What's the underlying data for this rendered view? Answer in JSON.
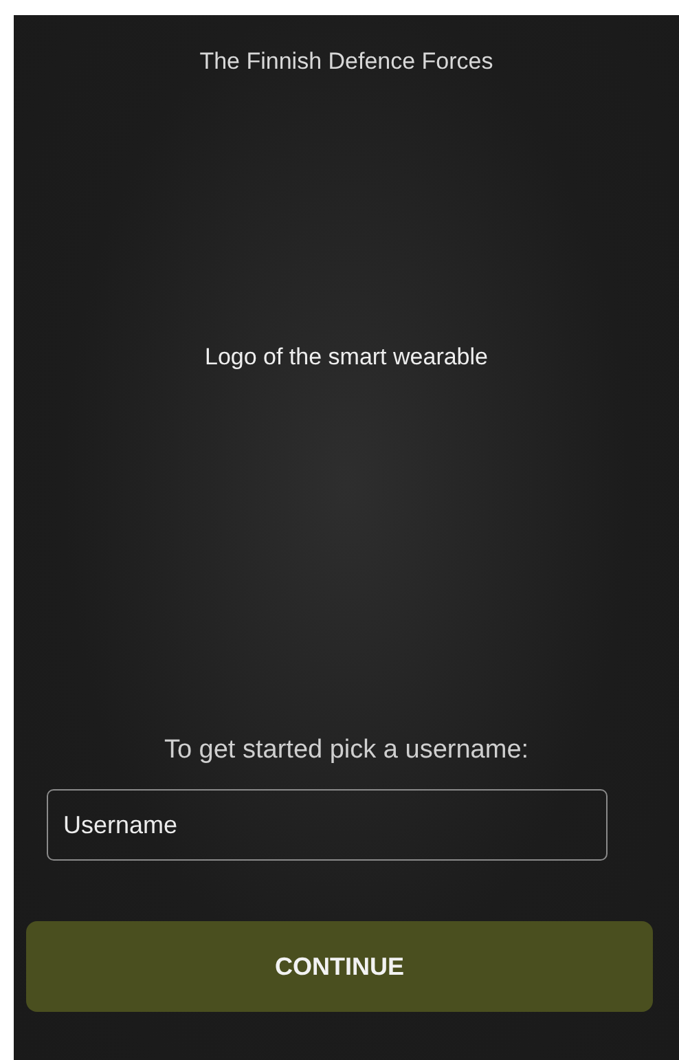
{
  "header": {
    "title": "The Finnish Defence Forces"
  },
  "logo": {
    "text": "Logo of the smart wearable"
  },
  "prompt": "To get started pick a username:",
  "username_field": {
    "placeholder": "Username"
  },
  "continue_button": {
    "label": "CONTINUE"
  }
}
